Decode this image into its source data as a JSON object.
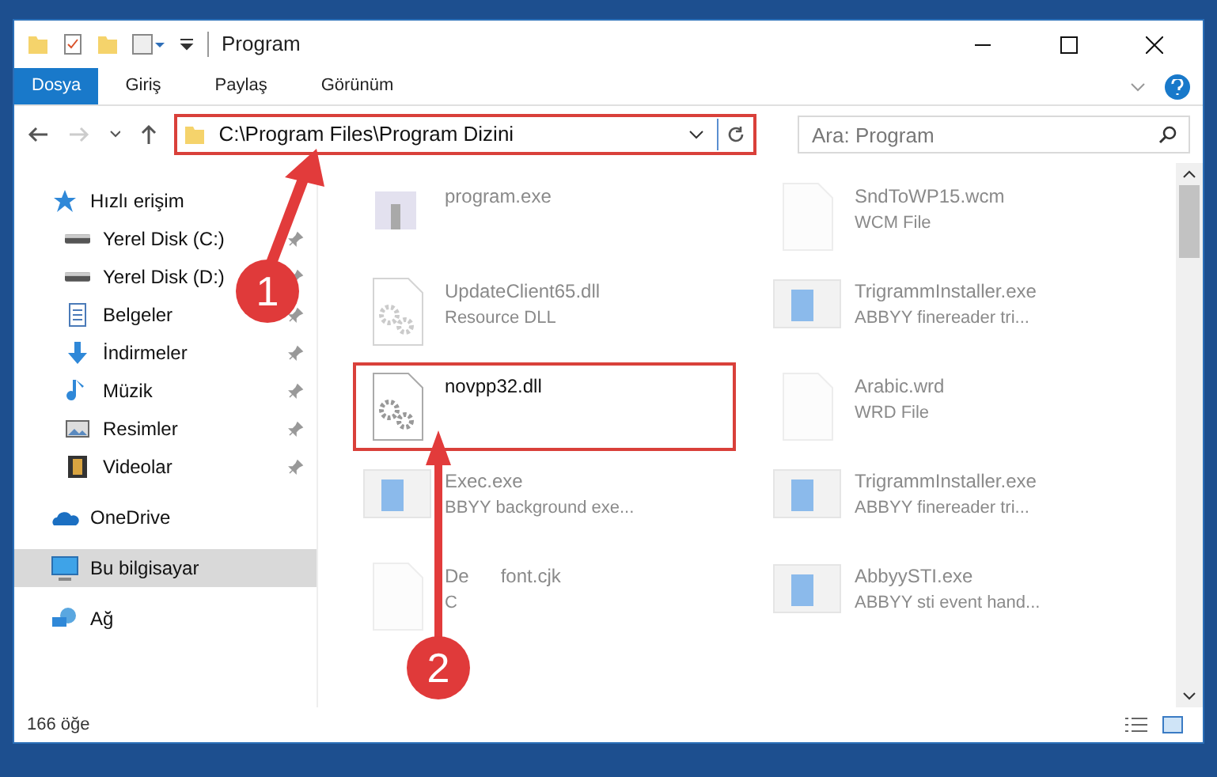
{
  "window": {
    "title": "Program"
  },
  "ribbon_tabs": [
    {
      "label": "Dosya",
      "selected": true
    },
    {
      "label": "Giriş",
      "selected": false
    },
    {
      "label": "Paylaş",
      "selected": false
    },
    {
      "label": "Görünüm",
      "selected": false
    }
  ],
  "address_bar": {
    "path": "C:\\Program Files\\Program Dizini"
  },
  "search": {
    "placeholder": "Ara: Program"
  },
  "sidebar": {
    "items": [
      {
        "label": "Hızlı erişim",
        "kind": "star",
        "selected": false,
        "children": [
          {
            "label": "Yerel Disk (C:)",
            "kind": "drive",
            "selected": false,
            "pinned": true
          },
          {
            "label": "Yerel Disk (D:)",
            "kind": "drive",
            "selected": false,
            "pinned": true
          },
          {
            "label": "Belgeler",
            "kind": "document",
            "selected": false,
            "pinned": true
          },
          {
            "label": "İndirmeler",
            "kind": "download",
            "selected": false,
            "pinned": true
          },
          {
            "label": "Müzik",
            "kind": "music",
            "selected": false,
            "pinned": true
          },
          {
            "label": "Resimler",
            "kind": "picture",
            "selected": false,
            "pinned": true
          },
          {
            "label": "Videolar",
            "kind": "video",
            "selected": false,
            "pinned": true
          }
        ]
      },
      {
        "label": "OneDrive",
        "kind": "cloud",
        "selected": false
      },
      {
        "label": "Bu bilgisayar",
        "kind": "computer",
        "selected": true
      },
      {
        "label": "Ağ",
        "kind": "network",
        "selected": false
      }
    ]
  },
  "files": [
    {
      "name": "program.exe",
      "kind": "app",
      "blurred": true
    },
    {
      "name": "SndToWP15.wcm",
      "description": "WCM File",
      "kind": "blank",
      "blurred": true
    },
    {
      "name": "UpdateClient65.dll",
      "description": "Resource DLL",
      "kind": "gear",
      "blurred": true
    },
    {
      "name": "TrigrammInstaller.exe",
      "description": "ABBYY finereader tri...",
      "kind": "window",
      "blurred": true
    },
    {
      "name": "novpp32.dll",
      "kind": "gear",
      "highlighted": true,
      "blurred": false
    },
    {
      "name": "Arabic.wrd",
      "description": "WRD File",
      "kind": "blank",
      "blurred": true
    },
    {
      "name": "Exec.exe",
      "description": "BBYY background exe...",
      "kind": "window",
      "blurred": true
    },
    {
      "name": "TrigrammInstaller.exe",
      "description": "ABBYY finereader tri...",
      "kind": "window",
      "blurred": true
    },
    {
      "name": "De      font.cjk",
      "description": "C",
      "kind": "blank",
      "blurred": true
    },
    {
      "name": "AbbyySTI.exe",
      "description": "ABBYY sti event hand...",
      "kind": "window",
      "blurred": true
    }
  ],
  "status_bar": {
    "count": "166 öğe"
  },
  "annotations": [
    {
      "number": "1"
    },
    {
      "number": "2"
    }
  ]
}
